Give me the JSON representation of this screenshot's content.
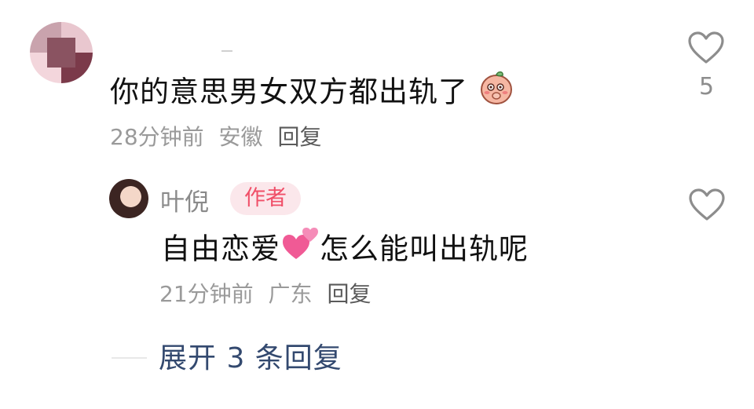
{
  "comment": {
    "text": "你的意思男女双方都出轨了",
    "time": "28分钟前",
    "location": "安徽",
    "reply_label": "回复",
    "likes": "5",
    "emoji": "blushing-peach-emoji"
  },
  "reply": {
    "author": "叶倪",
    "badge": "作者",
    "text_before": "自由恋爱",
    "emoji": "two-hearts-emoji",
    "text_after": "怎么能叫出轨呢",
    "time": "21分钟前",
    "location": "广东",
    "reply_label": "回复"
  },
  "expand": {
    "label": "展开 3 条回复"
  },
  "colors": {
    "text": "#111111",
    "meta": "#9a9a9a",
    "badge_bg": "#fbe7eb",
    "badge_text": "#f04f68",
    "link": "#33496f"
  }
}
